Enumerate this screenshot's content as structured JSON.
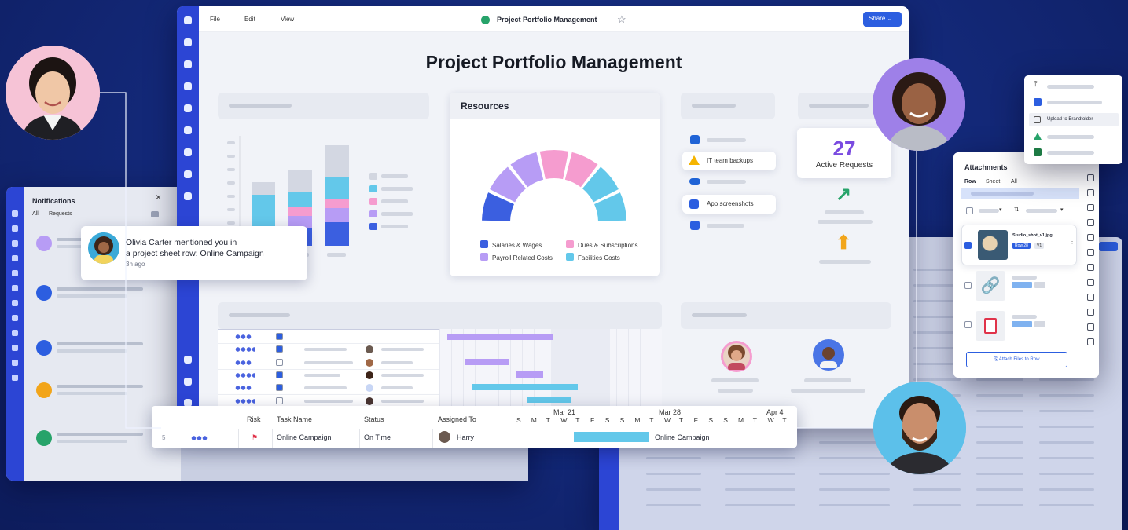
{
  "colors": {
    "background": "#142a7c",
    "sidebar": "#2c45d4",
    "share_button": "#2c5ee0",
    "salaries": "#3b5fe0",
    "payroll": "#b79cf5",
    "dues": "#f59ccf",
    "facilities": "#63c8ea",
    "active_requests_number": "#7a4be0",
    "arrow_up_green": "#27a36a",
    "arrow_up_orange": "#f2a51a"
  },
  "main_window": {
    "menu": [
      "File",
      "Edit",
      "View"
    ],
    "sheet_title": "Project Portfolio Management",
    "share_label": "Share",
    "dashboard_title": "Project Portfolio Management",
    "resources": {
      "title": "Resources",
      "legend": [
        "Salaries & Wages",
        "Dues & Subscriptions",
        "Payroll Related Costs",
        "Facilities Costs"
      ]
    },
    "file_links": [
      "IT team backups",
      "App screenshots"
    ],
    "active_requests": {
      "count": "27",
      "label": "Active Requests"
    }
  },
  "chart_data": {
    "type": "pie",
    "title": "Resources",
    "series": [
      {
        "name": "Salaries & Wages",
        "values": [
          2
        ]
      },
      {
        "name": "Payroll Related Costs",
        "values": [
          2
        ]
      },
      {
        "name": "Dues & Subscriptions",
        "values": [
          2
        ]
      },
      {
        "name": "Facilities Costs",
        "values": [
          2
        ]
      }
    ],
    "note_shape": "semicircle donut"
  },
  "notifications": {
    "title": "Notifications",
    "tabs": [
      "All",
      "Requests"
    ],
    "close": "×",
    "toast": {
      "line1": "Olivia Carter mentioned you in",
      "line2": "a project sheet row: Online Campaign",
      "time": "3h ago"
    }
  },
  "gantt_row": {
    "headers": [
      "Risk",
      "Task Name",
      "Status",
      "Assigned To"
    ],
    "row_number": "5",
    "task": "Online Campaign",
    "status": "On Time",
    "assigned": "Harry",
    "bar_label": "Online Campaign",
    "weeks": [
      "Mar 21",
      "Mar 28",
      "Apr 4"
    ],
    "days": [
      "S",
      "M",
      "T",
      "W",
      "T",
      "F",
      "S",
      "S",
      "M",
      "T",
      "W",
      "T",
      "F",
      "S",
      "S",
      "M",
      "T",
      "W",
      "T"
    ]
  },
  "attachments": {
    "title": "Attachments",
    "tabs": [
      "Row",
      "Sheet",
      "All"
    ],
    "file_name": "Studio_shot_v1.jpg",
    "row_badge": "Row 28",
    "version_badge": "V1",
    "attach_button": "Attach Files to Row"
  },
  "upload_menu": {
    "item": "Upload to Brandfolder"
  }
}
